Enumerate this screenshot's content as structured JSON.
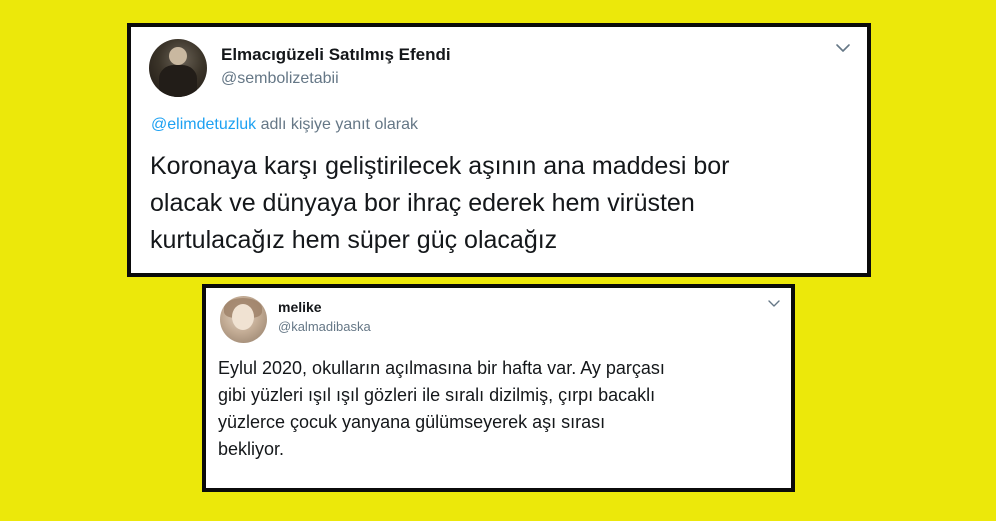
{
  "colors": {
    "background": "#ece80a",
    "card_border": "#0b0b0b",
    "card_background": "#ffffff",
    "name_text": "#14171a",
    "secondary_text": "#657786",
    "mention": "#1da1f2"
  },
  "tweets": [
    {
      "display_name": "Elmacıgüzeli Satılmış Efendi",
      "handle": "@sembolizetabii",
      "reply_to_mention": "@elimdetuzluk",
      "reply_to_suffix": " adlı kişiye yanıt olarak",
      "text_lines": [
        "Koronaya karşı geliştirilecek aşının ana maddesi bor",
        "olacak ve dünyaya bor ihraç ederek hem virüsten",
        "kurtulacağız hem süper güç olacağız"
      ],
      "menu_icon": "chevron-down-icon",
      "avatar_icon": "avatar"
    },
    {
      "display_name": "melike",
      "handle": "@kalmadibaska",
      "text_lines": [
        "Eylul 2020, okulların açılmasına bir hafta var. Ay parçası",
        "gibi yüzleri ışıl ışıl gözleri ile sıralı dizilmiş, çırpı bacaklı",
        "yüzlerce çocuk yanyana gülümseyerek aşı sırası",
        "bekliyor."
      ],
      "menu_icon": "chevron-down-icon",
      "avatar_icon": "avatar"
    }
  ]
}
